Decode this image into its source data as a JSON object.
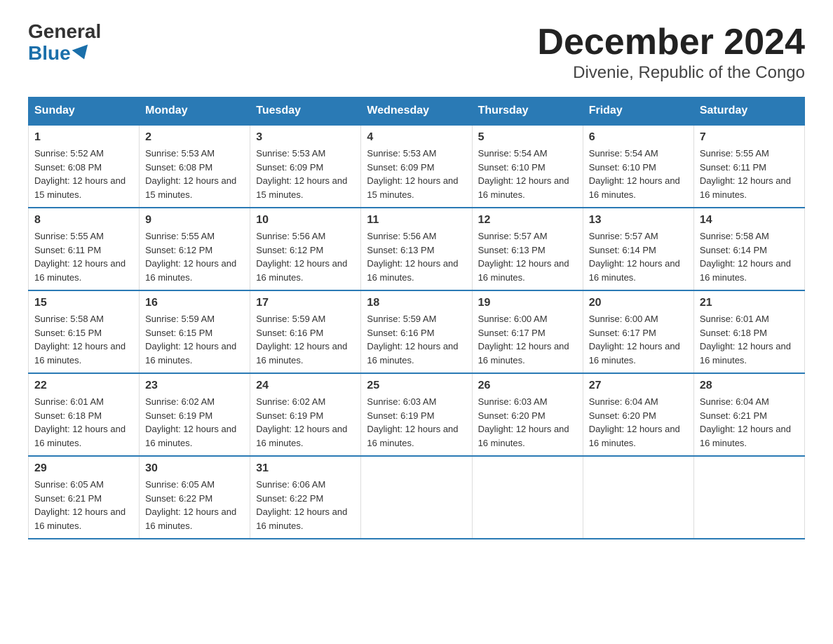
{
  "logo": {
    "line1": "General",
    "line2": "Blue"
  },
  "title": "December 2024",
  "subtitle": "Divenie, Republic of the Congo",
  "headers": [
    "Sunday",
    "Monday",
    "Tuesday",
    "Wednesday",
    "Thursday",
    "Friday",
    "Saturday"
  ],
  "weeks": [
    [
      {
        "day": "1",
        "sunrise": "5:52 AM",
        "sunset": "6:08 PM",
        "daylight": "12 hours and 15 minutes."
      },
      {
        "day": "2",
        "sunrise": "5:53 AM",
        "sunset": "6:08 PM",
        "daylight": "12 hours and 15 minutes."
      },
      {
        "day": "3",
        "sunrise": "5:53 AM",
        "sunset": "6:09 PM",
        "daylight": "12 hours and 15 minutes."
      },
      {
        "day": "4",
        "sunrise": "5:53 AM",
        "sunset": "6:09 PM",
        "daylight": "12 hours and 15 minutes."
      },
      {
        "day": "5",
        "sunrise": "5:54 AM",
        "sunset": "6:10 PM",
        "daylight": "12 hours and 16 minutes."
      },
      {
        "day": "6",
        "sunrise": "5:54 AM",
        "sunset": "6:10 PM",
        "daylight": "12 hours and 16 minutes."
      },
      {
        "day": "7",
        "sunrise": "5:55 AM",
        "sunset": "6:11 PM",
        "daylight": "12 hours and 16 minutes."
      }
    ],
    [
      {
        "day": "8",
        "sunrise": "5:55 AM",
        "sunset": "6:11 PM",
        "daylight": "12 hours and 16 minutes."
      },
      {
        "day": "9",
        "sunrise": "5:55 AM",
        "sunset": "6:12 PM",
        "daylight": "12 hours and 16 minutes."
      },
      {
        "day": "10",
        "sunrise": "5:56 AM",
        "sunset": "6:12 PM",
        "daylight": "12 hours and 16 minutes."
      },
      {
        "day": "11",
        "sunrise": "5:56 AM",
        "sunset": "6:13 PM",
        "daylight": "12 hours and 16 minutes."
      },
      {
        "day": "12",
        "sunrise": "5:57 AM",
        "sunset": "6:13 PM",
        "daylight": "12 hours and 16 minutes."
      },
      {
        "day": "13",
        "sunrise": "5:57 AM",
        "sunset": "6:14 PM",
        "daylight": "12 hours and 16 minutes."
      },
      {
        "day": "14",
        "sunrise": "5:58 AM",
        "sunset": "6:14 PM",
        "daylight": "12 hours and 16 minutes."
      }
    ],
    [
      {
        "day": "15",
        "sunrise": "5:58 AM",
        "sunset": "6:15 PM",
        "daylight": "12 hours and 16 minutes."
      },
      {
        "day": "16",
        "sunrise": "5:59 AM",
        "sunset": "6:15 PM",
        "daylight": "12 hours and 16 minutes."
      },
      {
        "day": "17",
        "sunrise": "5:59 AM",
        "sunset": "6:16 PM",
        "daylight": "12 hours and 16 minutes."
      },
      {
        "day": "18",
        "sunrise": "5:59 AM",
        "sunset": "6:16 PM",
        "daylight": "12 hours and 16 minutes."
      },
      {
        "day": "19",
        "sunrise": "6:00 AM",
        "sunset": "6:17 PM",
        "daylight": "12 hours and 16 minutes."
      },
      {
        "day": "20",
        "sunrise": "6:00 AM",
        "sunset": "6:17 PM",
        "daylight": "12 hours and 16 minutes."
      },
      {
        "day": "21",
        "sunrise": "6:01 AM",
        "sunset": "6:18 PM",
        "daylight": "12 hours and 16 minutes."
      }
    ],
    [
      {
        "day": "22",
        "sunrise": "6:01 AM",
        "sunset": "6:18 PM",
        "daylight": "12 hours and 16 minutes."
      },
      {
        "day": "23",
        "sunrise": "6:02 AM",
        "sunset": "6:19 PM",
        "daylight": "12 hours and 16 minutes."
      },
      {
        "day": "24",
        "sunrise": "6:02 AM",
        "sunset": "6:19 PM",
        "daylight": "12 hours and 16 minutes."
      },
      {
        "day": "25",
        "sunrise": "6:03 AM",
        "sunset": "6:19 PM",
        "daylight": "12 hours and 16 minutes."
      },
      {
        "day": "26",
        "sunrise": "6:03 AM",
        "sunset": "6:20 PM",
        "daylight": "12 hours and 16 minutes."
      },
      {
        "day": "27",
        "sunrise": "6:04 AM",
        "sunset": "6:20 PM",
        "daylight": "12 hours and 16 minutes."
      },
      {
        "day": "28",
        "sunrise": "6:04 AM",
        "sunset": "6:21 PM",
        "daylight": "12 hours and 16 minutes."
      }
    ],
    [
      {
        "day": "29",
        "sunrise": "6:05 AM",
        "sunset": "6:21 PM",
        "daylight": "12 hours and 16 minutes."
      },
      {
        "day": "30",
        "sunrise": "6:05 AM",
        "sunset": "6:22 PM",
        "daylight": "12 hours and 16 minutes."
      },
      {
        "day": "31",
        "sunrise": "6:06 AM",
        "sunset": "6:22 PM",
        "daylight": "12 hours and 16 minutes."
      },
      null,
      null,
      null,
      null
    ]
  ]
}
